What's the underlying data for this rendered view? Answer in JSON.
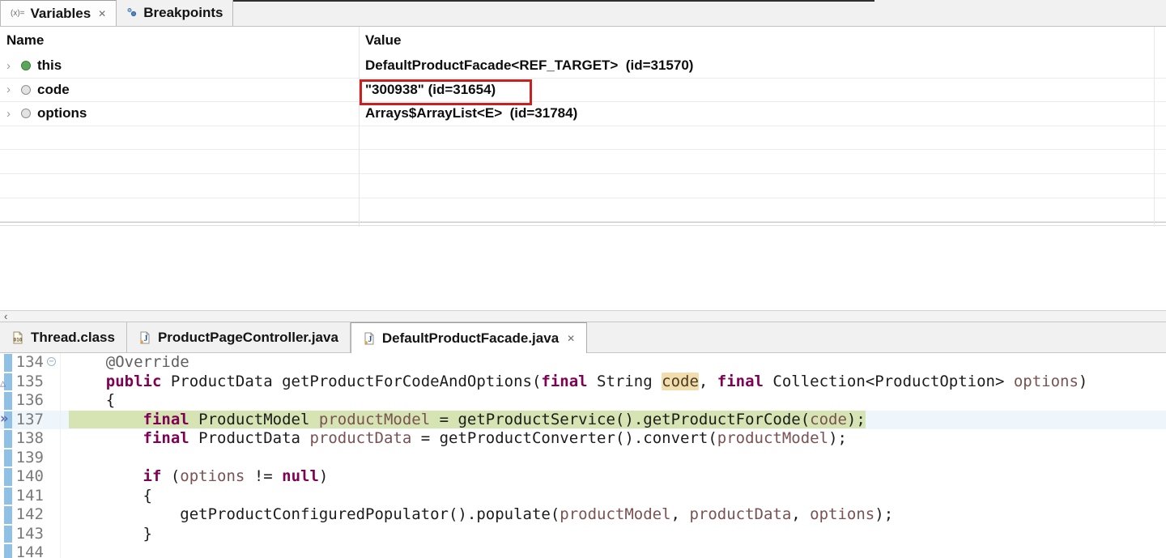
{
  "variables_view": {
    "tabs": [
      {
        "label": "Variables",
        "icon": "(x)=",
        "active": true,
        "closable": true
      },
      {
        "label": "Breakpoints",
        "icon": "breakpoints-dots",
        "active": false
      }
    ],
    "close_glyph": "✕",
    "columns": {
      "name": "Name",
      "value": "Value"
    },
    "rows": [
      {
        "name": "this",
        "icon": "green",
        "value": "DefaultProductFacade<REF_TARGET>  (id=31570)",
        "highlighted": false
      },
      {
        "name": "code",
        "icon": "gray",
        "value": "\"300938\" (id=31654)",
        "highlighted": true
      },
      {
        "name": "options",
        "icon": "gray",
        "value": "Arrays$ArrayList<E>  (id=31784)",
        "highlighted": false
      }
    ],
    "empty_row_count": 4,
    "twistie_glyph": "›",
    "scroll_left_glyph": "‹",
    "highlight_box_color": "#c92020"
  },
  "editor": {
    "tabs": [
      {
        "label": "Thread.class",
        "icon": "class-file",
        "active": false
      },
      {
        "label": "ProductPageController.java",
        "icon": "java-file",
        "active": false
      },
      {
        "label": "DefaultProductFacade.java",
        "icon": "java-file",
        "active": true,
        "closable": true
      }
    ],
    "colors": {
      "keyword": "#7f0055",
      "annotation": "#5f5f5f",
      "variable": "#7a5252",
      "occurrence_bg": "#f1ddae",
      "current_line_bg": "#d5e4b2",
      "current_row_bg": "#eef5fb"
    },
    "markers": {
      "fold_collapse": "−",
      "override_triangle": "△",
      "instruction_pointer": "»"
    },
    "lines": [
      {
        "num": "134",
        "fold": true,
        "segments": [
          [
            "seg-a",
            "    @Override"
          ]
        ]
      },
      {
        "num": "135",
        "marker": "tri",
        "segments": [
          [
            "seg-p",
            "    "
          ],
          [
            "seg-k",
            "public"
          ],
          [
            "seg-p",
            " ProductData getProductForCodeAndOptions("
          ],
          [
            "seg-k",
            "final"
          ],
          [
            "seg-p",
            " String "
          ],
          [
            "seg-o",
            "code"
          ],
          [
            "seg-p",
            ", "
          ],
          [
            "seg-k",
            "final"
          ],
          [
            "seg-p",
            " Collection<ProductOption> "
          ],
          [
            "seg-v",
            "options"
          ],
          [
            "seg-p",
            ")"
          ]
        ]
      },
      {
        "num": "136",
        "segments": [
          [
            "seg-p",
            "    {"
          ]
        ]
      },
      {
        "num": "137",
        "marker": "ip",
        "current": true,
        "segments": [
          [
            "seg-p",
            "        "
          ],
          [
            "seg-k",
            "final"
          ],
          [
            "seg-p",
            " ProductModel "
          ],
          [
            "seg-v",
            "productModel"
          ],
          [
            "seg-p",
            " = getProductService().getProductForCode("
          ],
          [
            "seg-v",
            "code"
          ],
          [
            "seg-p",
            ");"
          ]
        ]
      },
      {
        "num": "138",
        "segments": [
          [
            "seg-p",
            "        "
          ],
          [
            "seg-k",
            "final"
          ],
          [
            "seg-p",
            " ProductData "
          ],
          [
            "seg-v",
            "productData"
          ],
          [
            "seg-p",
            " = getProductConverter().convert("
          ],
          [
            "seg-v",
            "productModel"
          ],
          [
            "seg-p",
            ");"
          ]
        ]
      },
      {
        "num": "139",
        "segments": []
      },
      {
        "num": "140",
        "segments": [
          [
            "seg-p",
            "        "
          ],
          [
            "seg-k",
            "if"
          ],
          [
            "seg-p",
            " ("
          ],
          [
            "seg-v",
            "options"
          ],
          [
            "seg-p",
            " != "
          ],
          [
            "seg-k",
            "null"
          ],
          [
            "seg-p",
            ")"
          ]
        ]
      },
      {
        "num": "141",
        "segments": [
          [
            "seg-p",
            "        {"
          ]
        ]
      },
      {
        "num": "142",
        "segments": [
          [
            "seg-p",
            "            getProductConfiguredPopulator().populate("
          ],
          [
            "seg-v",
            "productModel"
          ],
          [
            "seg-p",
            ", "
          ],
          [
            "seg-v",
            "productData"
          ],
          [
            "seg-p",
            ", "
          ],
          [
            "seg-v",
            "options"
          ],
          [
            "seg-p",
            ");"
          ]
        ]
      },
      {
        "num": "143",
        "segments": [
          [
            "seg-p",
            "        }"
          ]
        ]
      },
      {
        "num": "144",
        "segments": []
      }
    ]
  }
}
